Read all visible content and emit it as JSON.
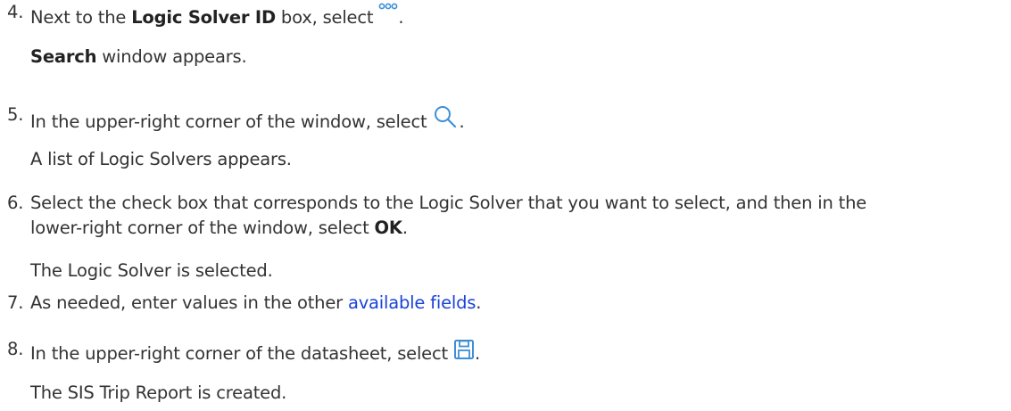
{
  "steps": [
    {
      "number": "4.",
      "prefix": "Next to the ",
      "bold": "Logic Solver ID",
      "mid": " box, select ",
      "suffix": ".",
      "icon": "more-options-icon",
      "result_bold": "Search",
      "result_rest": " window appears."
    },
    {
      "number": "5.",
      "text": "In the upper-right corner of the window, select ",
      "suffix": ".",
      "icon": "search-icon",
      "result": "A list of Logic Solvers appears."
    },
    {
      "number": "6.",
      "line1": "Select the check box that corresponds to the Logic Solver that you want to select, and then in the",
      "line2_prefix": "lower-right corner of the window, select ",
      "line2_bold": "OK",
      "line2_suffix": ".",
      "result": "The Logic Solver is selected."
    },
    {
      "number": "7.",
      "prefix": "As needed, enter values in the other ",
      "link": "available fields",
      "suffix": "."
    },
    {
      "number": "8.",
      "text": "In the upper-right corner of the datasheet, select ",
      "suffix": ".",
      "icon": "save-icon",
      "result": "The SIS Trip Report is created."
    }
  ],
  "colors": {
    "text": "#333333",
    "link": "#1a43d8",
    "icon_blue": "#3d8fd6"
  }
}
